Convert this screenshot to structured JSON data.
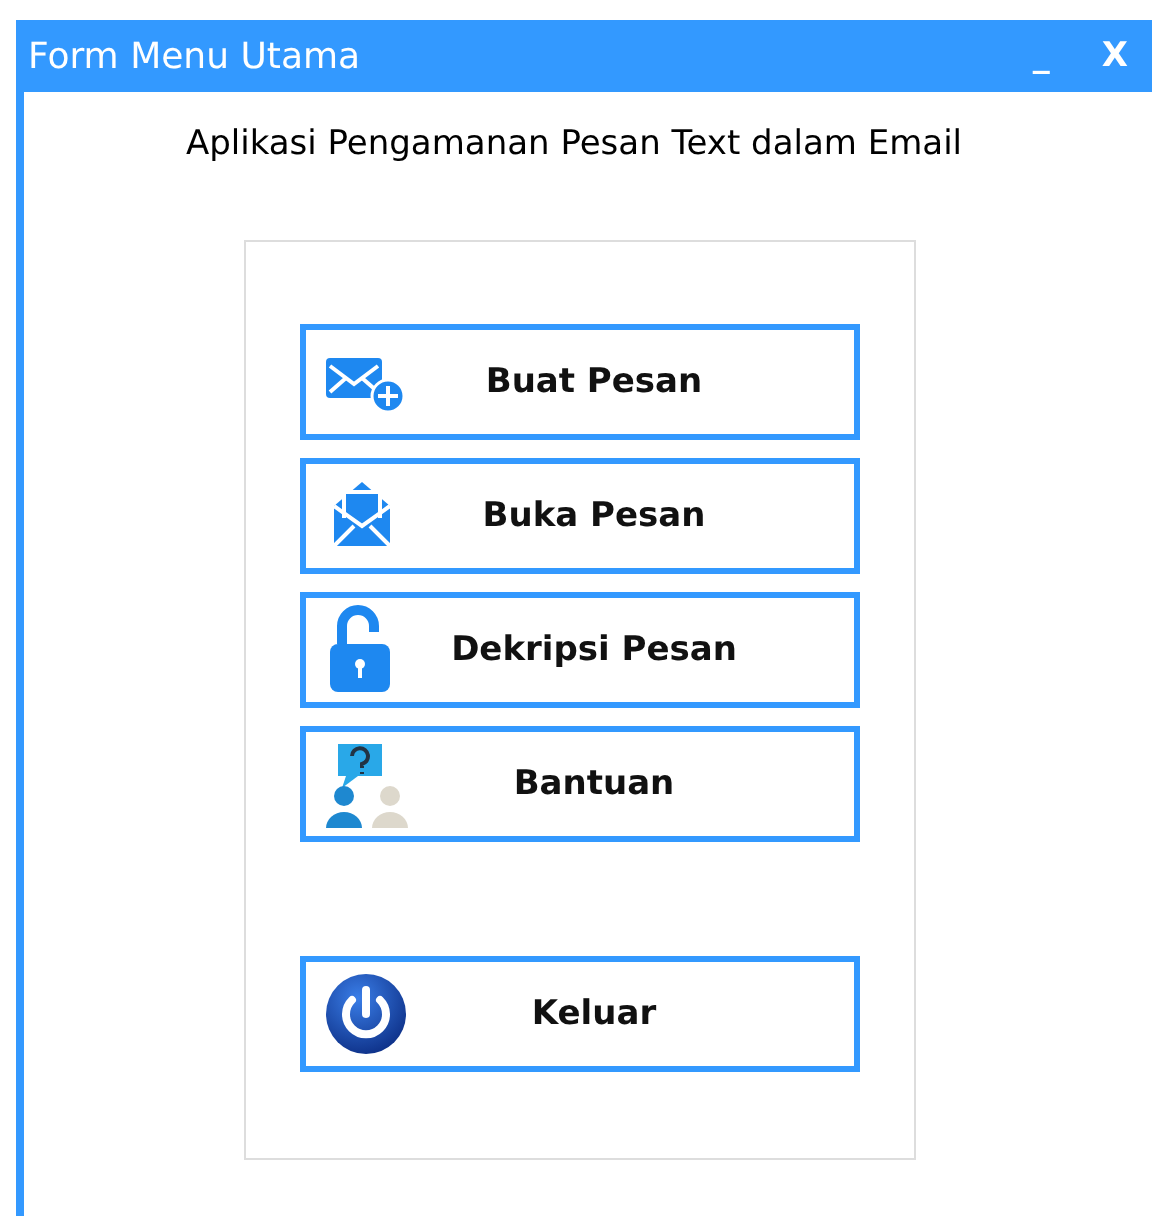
{
  "window": {
    "title": "Form Menu Utama",
    "controls": [
      "_",
      "X"
    ]
  },
  "heading": "Aplikasi Pengamanan Pesan Text dalam Email",
  "buttons": [
    {
      "label": "Buat Pesan",
      "kind": "compose"
    },
    {
      "label": "Buka Pesan",
      "kind": "open"
    },
    {
      "label": "Dekripsi Pesan",
      "kind": "unlock"
    },
    {
      "label": "Bantuan",
      "kind": "help"
    },
    {
      "label": "Keluar",
      "kind": "power"
    }
  ]
}
